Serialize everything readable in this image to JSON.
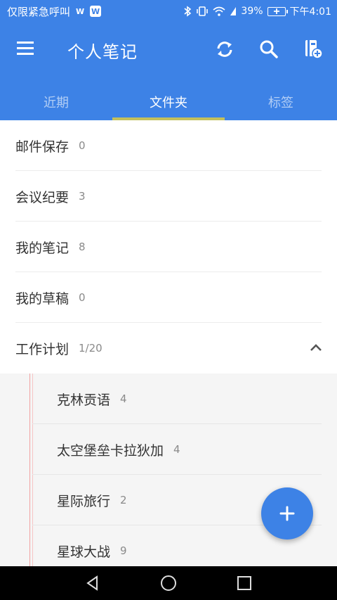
{
  "status_bar": {
    "carrier_text": "仅限紧急呼叫",
    "badge1": "W",
    "badge2": "W",
    "battery_percent": "39%",
    "time": "下午4:01"
  },
  "app_bar": {
    "title": "个人笔记",
    "icons": [
      "menu-icon",
      "sync-icon",
      "search-icon",
      "new-notebook-icon"
    ]
  },
  "tabs": [
    {
      "label": "近期",
      "active": false
    },
    {
      "label": "文件夹",
      "active": true
    },
    {
      "label": "标签",
      "active": false
    }
  ],
  "folders": [
    {
      "name": "邮件保存",
      "count": "0"
    },
    {
      "name": "会议纪要",
      "count": "3"
    },
    {
      "name": "我的笔记",
      "count": "8"
    },
    {
      "name": "我的草稿",
      "count": "0"
    },
    {
      "name": "工作计划",
      "count": "1/20",
      "expanded": true
    }
  ],
  "subfolders": [
    {
      "name": "克林贡语",
      "count": "4"
    },
    {
      "name": "太空堡垒卡拉狄加",
      "count": "4"
    },
    {
      "name": "星际旅行",
      "count": "2"
    },
    {
      "name": "星球大战",
      "count": "9"
    }
  ],
  "colors": {
    "primary": "#3d82e6",
    "tab_indicator": "#c3c05c"
  },
  "fab_icon": "plus-icon",
  "nav_icons": [
    "back-icon",
    "home-icon",
    "recents-icon"
  ]
}
